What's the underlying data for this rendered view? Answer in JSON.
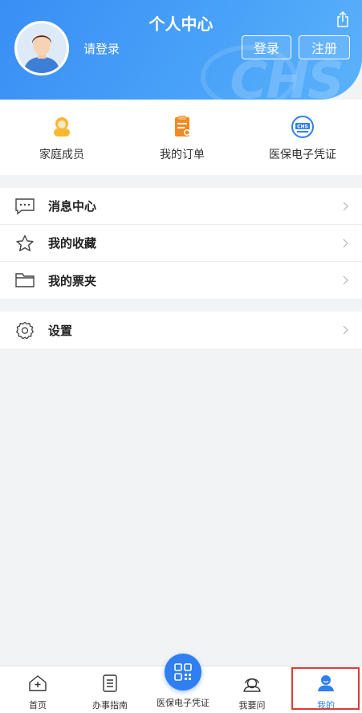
{
  "header": {
    "title": "个人中心",
    "login_hint": "请登录",
    "login_button": "登录",
    "register_button": "注册",
    "watermark": "CHS",
    "share_icon": "share-icon"
  },
  "quick_entries": [
    {
      "label": "家庭成员",
      "icon": "family-icon"
    },
    {
      "label": "我的订单",
      "icon": "order-icon"
    },
    {
      "label": "医保电子凭证",
      "icon": "chs-badge-icon"
    }
  ],
  "menu_group_1": [
    {
      "label": "消息中心",
      "icon": "message-icon"
    },
    {
      "label": "我的收藏",
      "icon": "star-icon"
    },
    {
      "label": "我的票夹",
      "icon": "folder-icon"
    }
  ],
  "menu_group_2": [
    {
      "label": "设置",
      "icon": "gear-icon"
    }
  ],
  "tabbar": {
    "tabs": [
      {
        "label": "首页",
        "icon": "home-icon"
      },
      {
        "label": "办事指南",
        "icon": "guide-icon"
      },
      {
        "label": "医保电子凭证",
        "icon": "qrcode-icon"
      },
      {
        "label": "我要问",
        "icon": "consult-icon"
      },
      {
        "label": "我的",
        "icon": "profile-icon"
      }
    ],
    "active_index": 4
  },
  "colors": {
    "primary": "#2f7ff0",
    "header_gradient_start": "#3a8ef5",
    "background": "#f2f3f5",
    "highlight_frame": "#e03a35"
  }
}
